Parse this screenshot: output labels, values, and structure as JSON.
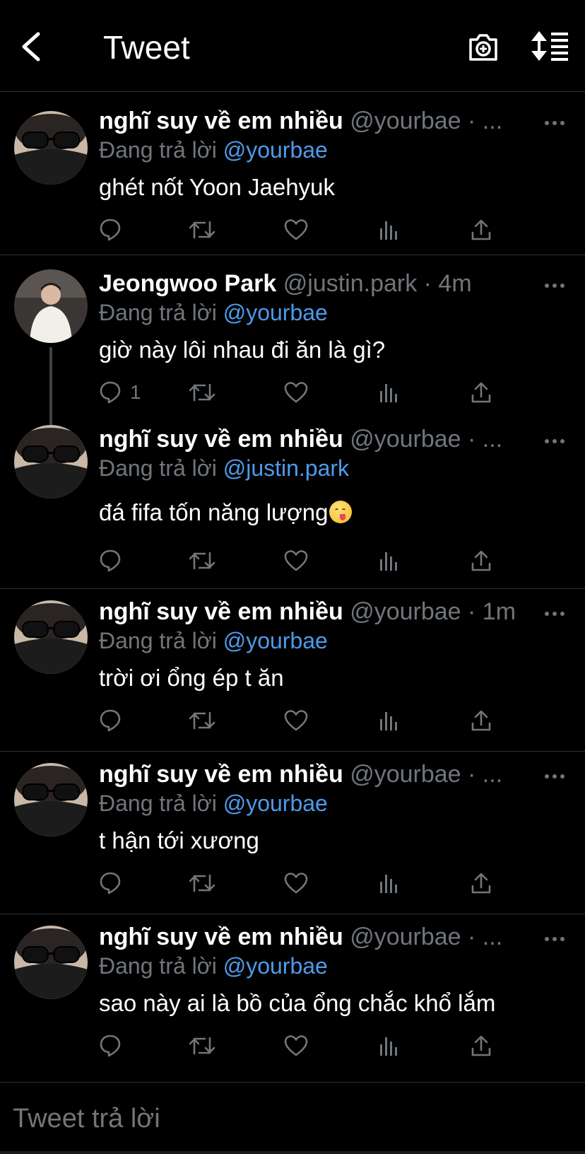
{
  "header": {
    "title": "Tweet"
  },
  "tweets": [
    {
      "name": "nghĩ suy về em nhiều",
      "handle": "@yourbae · ...",
      "reply_label": "Đang trả lời ",
      "reply_to": "@yourbae",
      "text": "ghét nốt Yoon Jaehyuk",
      "reply_count": "",
      "avatar": "person-glasses"
    },
    {
      "name": "Jeongwoo Park",
      "handle": "@justin.park · 4m",
      "reply_label": "Đang trả lời ",
      "reply_to": "@yourbae",
      "text": "giờ này lôi nhau đi ăn là gì?",
      "reply_count": "1",
      "avatar": "person-white-shirt"
    },
    {
      "name": "nghĩ suy về em nhiều",
      "handle": "@yourbae · ...",
      "reply_label": "Đang trả lời ",
      "reply_to": "@justin.park",
      "text": "đá fifa tốn năng lượng",
      "reply_count": "",
      "avatar": "person-glasses",
      "emoji": "savoring-food-emoji"
    },
    {
      "name": "nghĩ suy về em nhiều",
      "handle": "@yourbae · 1m",
      "reply_label": "Đang trả lời ",
      "reply_to": "@yourbae",
      "text": "trời ơi ổng ép t ăn",
      "reply_count": "",
      "avatar": "person-glasses"
    },
    {
      "name": "nghĩ suy về em nhiều",
      "handle": "@yourbae · ...",
      "reply_label": "Đang trả lời ",
      "reply_to": "@yourbae",
      "text": "t hận tới xương",
      "reply_count": "",
      "avatar": "person-glasses"
    },
    {
      "name": "nghĩ suy về em nhiều",
      "handle": "@yourbae · ...",
      "reply_label": "Đang trả lời ",
      "reply_to": "@yourbae",
      "text": "sao này ai là bồ của ổng chắc khổ lắm",
      "reply_count": "",
      "avatar": "person-glasses"
    }
  ],
  "composer": {
    "placeholder": "Tweet trả lời"
  },
  "colors": {
    "background": "#000000",
    "mention": "#4e9aeb",
    "muted": "#71767b",
    "divider": "#2f3336"
  }
}
